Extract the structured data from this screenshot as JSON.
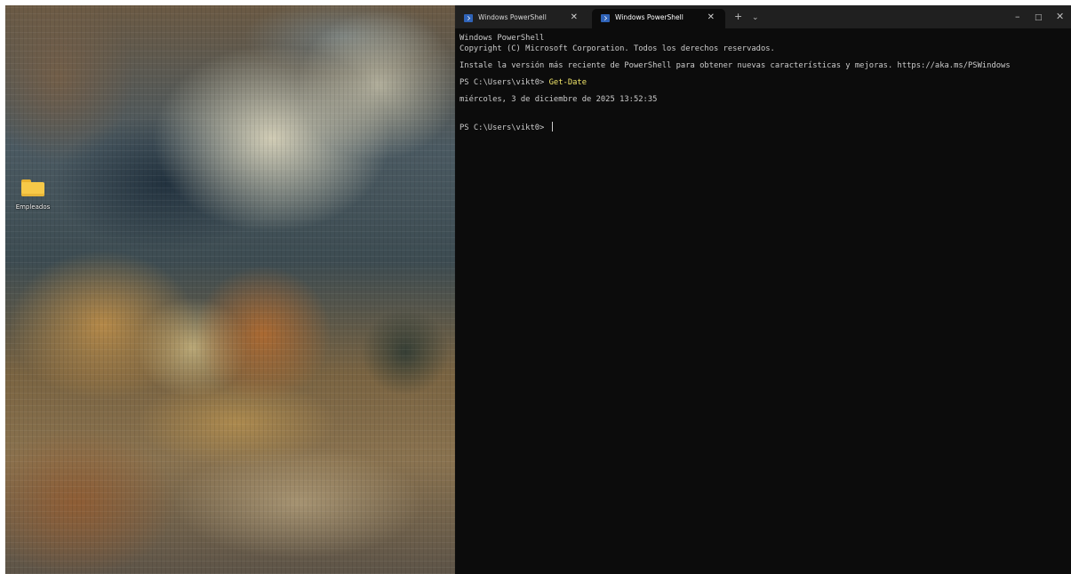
{
  "desktop": {
    "icons": [
      {
        "label": "Empleados",
        "icon": "folder-icon"
      }
    ]
  },
  "terminal": {
    "tabs": [
      {
        "title": "Windows PowerShell",
        "active": false
      },
      {
        "title": "Windows PowerShell",
        "active": true
      }
    ],
    "new_tab": "+",
    "dropdown": "⌄",
    "window_controls": {
      "minimize": "–",
      "maximize": "□",
      "close": "✕"
    },
    "close_tab": "✕",
    "lines": {
      "header1": "Windows PowerShell",
      "header2": "Copyright (C) Microsoft Corporation. Todos los derechos reservados.",
      "install_msg": "Instale la versión más reciente de PowerShell para obtener nuevas características y mejoras. https://aka.ms/PSWindows",
      "prompt1": "PS C:\\Users\\vikt0> ",
      "command1": "Get-Date",
      "output1": "miércoles, 3 de diciembre de 2025 13:52:35",
      "prompt2": "PS C:\\Users\\vikt0> "
    }
  },
  "colors": {
    "terminal_bg": "#0c0c0c",
    "tabbar_bg": "#202020",
    "command_color": "#f1e56a",
    "folder_color": "#f7c948"
  }
}
